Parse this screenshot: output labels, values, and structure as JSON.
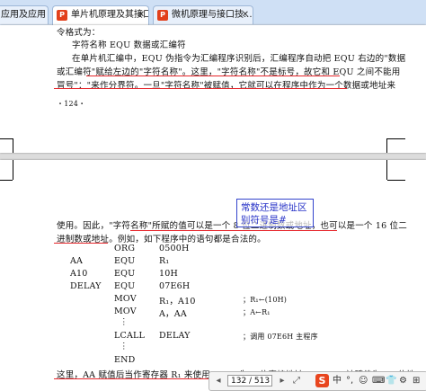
{
  "tabs": [
    {
      "label": "应用及应用 21...",
      "active": false
    },
    {
      "label": "单片机原理及其接口...",
      "active": true
    },
    {
      "label": "微机原理与接口技...",
      "active": false
    }
  ],
  "page1": {
    "lines": [
      "令格式为：",
      "字符名称    EQU    数据或汇编符",
      "在单片机汇编中，EQU 伪指令为汇编程序识别后，汇编程序自动把 EQU 右边的\"数据",
      "或汇编符\"赋给左边的\"字符名称\"。这里，\"字符名称\"不是标号，故它和 EQU 之间不能用",
      "冒号\"：\"来作分界符。一旦\"字符名称\"被赋值，它就可以在程序中作为一个数据或地址来",
      "・124・"
    ]
  },
  "page2": {
    "para": [
      "使用。因此，\"字符名称\"所赋的值可以是一个 8 位二进制数或地址，也可以是一个 16 位二",
      "进制数或地址。例如，如下程序中的语句都是合法的。"
    ],
    "code": [
      {
        "label": "",
        "op": "ORG",
        "operand": "0500H",
        "comment": ""
      },
      {
        "label": "AA",
        "op": "EQU",
        "operand": "R₁",
        "comment": ""
      },
      {
        "label": "A10",
        "op": "EQU",
        "operand": "10H",
        "comment": ""
      },
      {
        "label": "DELAY",
        "op": "EQU",
        "operand": "07E6H",
        "comment": ""
      },
      {
        "label": "",
        "op": "MOV",
        "operand": "R₁，A10",
        "comment": "；R₁←(10H)"
      },
      {
        "label": "",
        "op": "MOV",
        "operand": "A，AA",
        "comment": "；A←R₁"
      },
      {
        "label": "",
        "op": "⋮",
        "operand": "",
        "comment": ""
      },
      {
        "label": "",
        "op": "LCALL",
        "operand": "DELAY",
        "comment": "；调用 07E6H 主程序"
      },
      {
        "label": "",
        "op": "⋮",
        "operand": "",
        "comment": ""
      },
      {
        "label": "",
        "op": "END",
        "operand": "",
        "comment": ""
      }
    ],
    "last_line": "这里，AA 赋值后当作寄存器 R₁ 来使用，A10 为 8 位直接地址，DELAY 被赋值为 16 位地"
  },
  "annotation": {
    "line1": "常数还是地址区",
    "line2": "别符号是#",
    "color": "#2a35c8"
  },
  "toolbar": {
    "page_current": "132 / 513",
    "page_total": "",
    "ime": [
      "S",
      "中",
      "°,",
      "☺",
      "⌨",
      "👕",
      "⚙",
      "⊞"
    ]
  },
  "colors": {
    "annotation_underline": "#e6272c",
    "tab_bar": "#cfe0f5",
    "pdf_icon": "#e2401c"
  }
}
